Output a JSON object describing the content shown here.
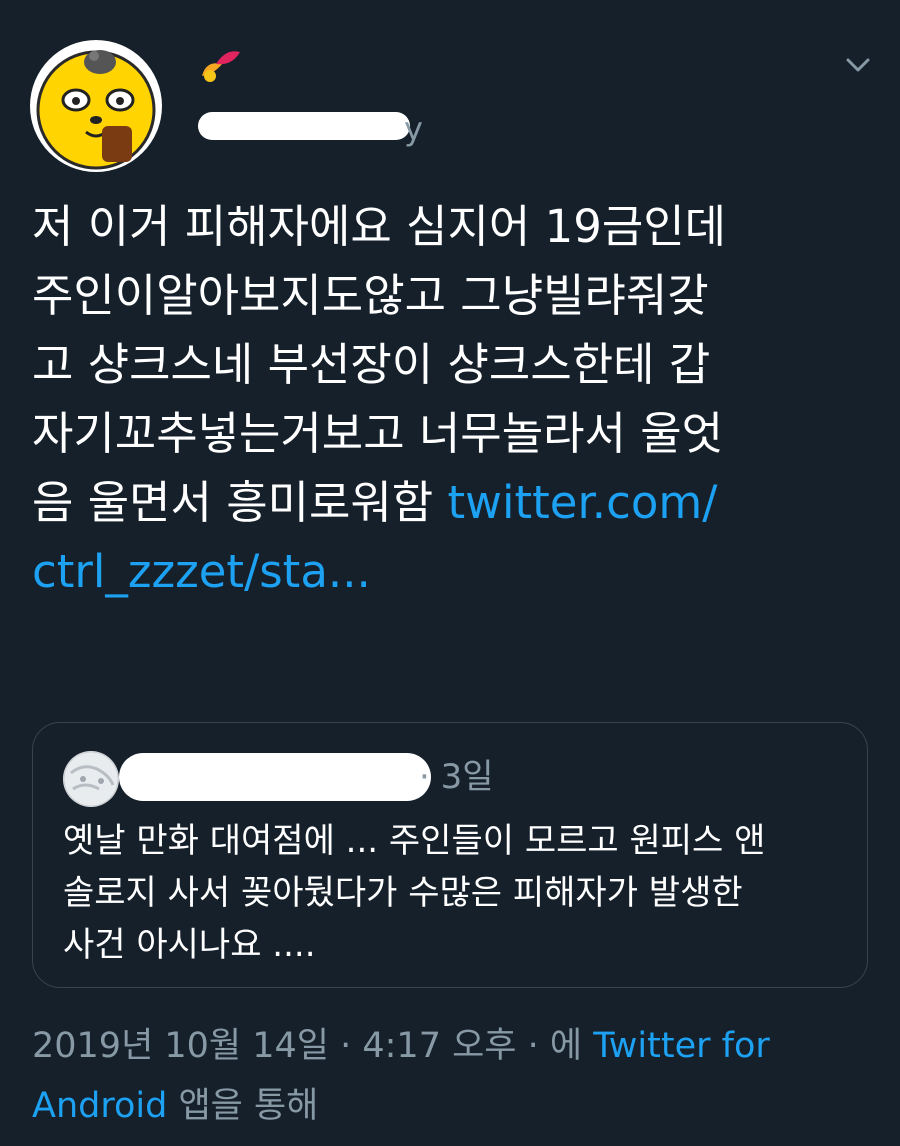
{
  "tweet": {
    "handle_tail": "y",
    "text_lines": [
      "저 이거 피해자에요 심지어 19금인데",
      "주인이알아보지도않고 그냥빌랴줘갖",
      "고 샹크스네 부선장이 샹크스한테 갑",
      "자기꼬추넣는거보고 너무놀라서 울엇",
      "음 울면서 흥미로워함 "
    ],
    "link_part1": "twitter.com/",
    "link_part2": "ctrl_zzzet/sta..."
  },
  "quoted": {
    "time": "· 3일",
    "text": "옛날 만화 대여점에 ... 주인들이 모르고 원피스 앤\n솔로지 사서 꽂아뒀다가 수많은 피해자가 발생한\n사건 아시나요 ...."
  },
  "meta": {
    "date": "2019년 10월 14일 · 4:17 오후 · 에 ",
    "source_part1": "Twitter for",
    "source_part2": "Android",
    "suffix": " 앱을 통해"
  },
  "icons": {
    "avatar": "cartoon-character-avatar",
    "name_emoji": "emoji-icon",
    "caret": "chevron-down-icon",
    "quoted_avatar": "avatar"
  },
  "colors": {
    "background": "#15202b",
    "link": "#1da1f2",
    "secondary_text": "#8899a6",
    "border": "#38444d"
  }
}
